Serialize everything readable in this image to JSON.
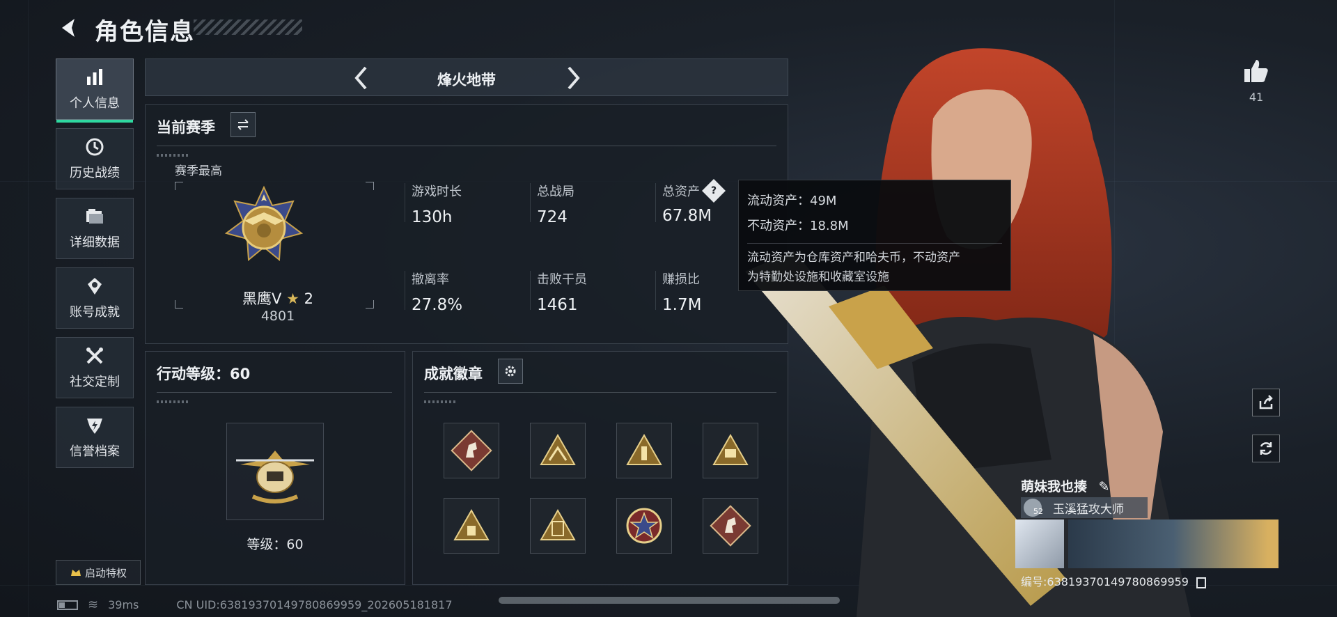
{
  "header": {
    "title": "角色信息"
  },
  "sidebar": {
    "items": [
      {
        "label": "个人信息",
        "icon": "bar-chart-icon",
        "active": true
      },
      {
        "label": "历史战绩",
        "icon": "clock-icon",
        "active": false
      },
      {
        "label": "详细数据",
        "icon": "folder-icon",
        "active": false
      },
      {
        "label": "账号成就",
        "icon": "medal-icon",
        "active": false
      },
      {
        "label": "社交定制",
        "icon": "tools-icon",
        "active": false
      },
      {
        "label": "信誉档案",
        "icon": "shield-icon",
        "active": false
      }
    ],
    "privilege_label": "启动特权"
  },
  "mode": {
    "title": "烽火地带"
  },
  "season": {
    "title": "当前赛季",
    "best_label": "赛季最高",
    "rank_name": "黑鹰V",
    "rank_stars": "2",
    "rank_score": "4801",
    "stats": [
      {
        "label": "游戏时长",
        "value": "130h"
      },
      {
        "label": "总战局",
        "value": "724"
      },
      {
        "label": "总资产",
        "value": "67.8M"
      },
      {
        "label": "撤离率",
        "value": "27.8%"
      },
      {
        "label": "击败干员",
        "value": "1461"
      },
      {
        "label": "赚损比",
        "value": "1.7M"
      }
    ]
  },
  "tooltip": {
    "liquid": "流动资产：49M",
    "fixed": "不动资产：18.8M",
    "desc_line1": "流动资产为仓库资产和哈夫币，不动资产",
    "desc_line2": "为特勤处设施和收藏室设施"
  },
  "action_level": {
    "title": "行动等级：60",
    "level_text": "等级：60"
  },
  "badges": {
    "title": "成就徽章",
    "items": [
      "horse-badge",
      "triangle-badge",
      "triangle-badge",
      "triangle-badge",
      "triangle-badge",
      "triangle-badge",
      "star-badge",
      "horse-badge"
    ]
  },
  "status_bar": {
    "ping": "39ms",
    "uid": "CN UID:63819370149780869959_202605181817"
  },
  "profile": {
    "likes": "41",
    "name": "萌妹我也揍",
    "rank_level": "52",
    "rank_title": "玉溪猛攻大师",
    "id_text": "编号:63819370149780869959"
  },
  "colors": {
    "accent_green": "#2fd8a0",
    "panel_bg": "#181e26",
    "gold": "#c9a24a"
  }
}
